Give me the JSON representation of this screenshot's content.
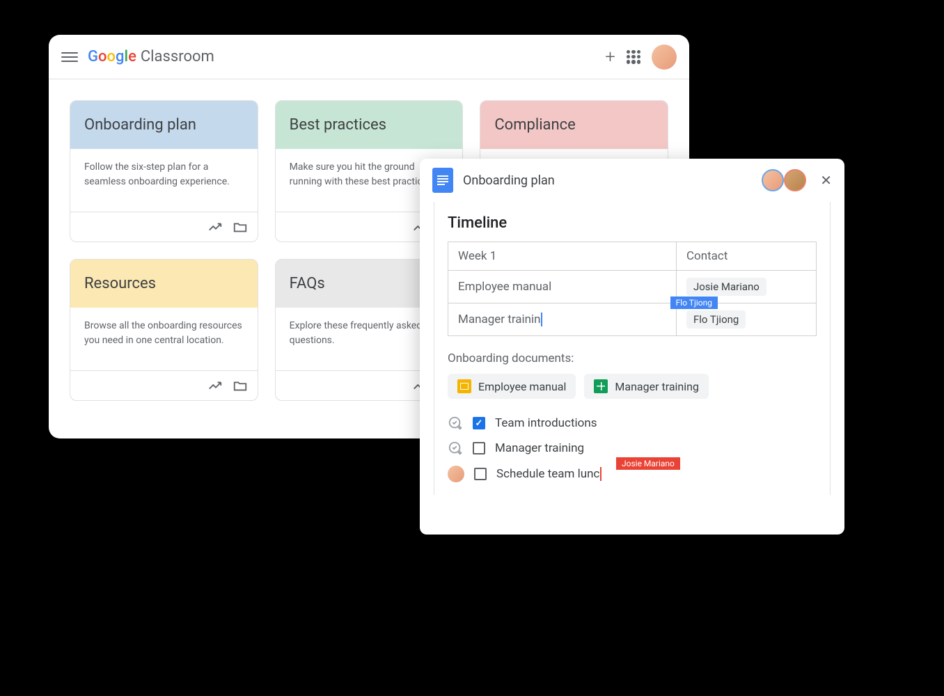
{
  "classroom": {
    "logo_text": "Google",
    "app_name": " Classroom",
    "cards": [
      {
        "title": "Onboarding plan",
        "desc": "Follow the six-step plan for a seamless onboarding experience.",
        "color": "blue"
      },
      {
        "title": "Best practices",
        "desc": "Make sure you hit the ground running with these best practices.",
        "color": "green"
      },
      {
        "title": "Compliance",
        "desc": "",
        "color": "pink"
      },
      {
        "title": "Resources",
        "desc": "Browse all the onboarding resources you need in one central location.",
        "color": "yellow"
      },
      {
        "title": "FAQs",
        "desc": "Explore these frequently asked questions.",
        "color": "grey"
      }
    ]
  },
  "docs": {
    "title": "Onboarding plan",
    "timeline_heading": "Timeline",
    "table": {
      "header_week": "Week 1",
      "header_contact": "Contact",
      "row1_item": "Employee manual",
      "row1_contact": "Josie Mariano",
      "row2_item": "Manager trainin",
      "row2_contact": "Flo Tjiong",
      "cursor_user_blue": "Flo Tjiong"
    },
    "documents_label": "Onboarding documents:",
    "doc_chips": [
      {
        "label": "Employee manual",
        "type": "slides"
      },
      {
        "label": "Manager training",
        "type": "sheets"
      }
    ],
    "tasks": [
      {
        "label": "Team introductions",
        "checked": true,
        "leader": "icon"
      },
      {
        "label": "Manager training",
        "checked": false,
        "leader": "icon"
      },
      {
        "label": "Schedule team lunc",
        "checked": false,
        "leader": "avatar",
        "cursor_user": "Josie Mariano"
      }
    ]
  }
}
